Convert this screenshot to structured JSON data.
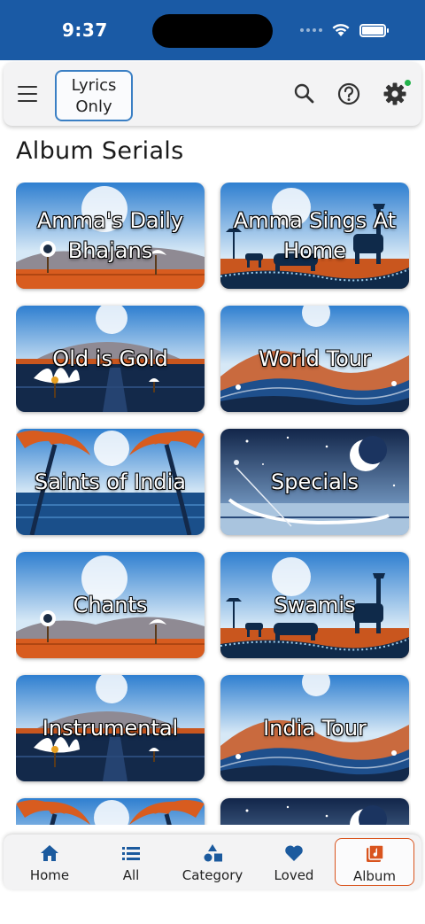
{
  "status_bar": {
    "time": "9:37"
  },
  "top_bar": {
    "lyrics_button_line1": "Lyrics",
    "lyrics_button_line2": "Only"
  },
  "section": {
    "title": "Album Serials"
  },
  "albums": [
    {
      "label": "Amma's Daily Bhajans",
      "scene": "lake"
    },
    {
      "label": "Amma Sings At Home",
      "scene": "animals"
    },
    {
      "label": "Old is Gold",
      "scene": "lotus"
    },
    {
      "label": "World Tour",
      "scene": "waves"
    },
    {
      "label": "Saints of India",
      "scene": "palms"
    },
    {
      "label": "Specials",
      "scene": "night"
    },
    {
      "label": "Chants",
      "scene": "lake"
    },
    {
      "label": "Swamis",
      "scene": "animals"
    },
    {
      "label": "Instrumental",
      "scene": "lotus"
    },
    {
      "label": "India Tour",
      "scene": "waves"
    },
    {
      "label": "",
      "scene": "palms"
    },
    {
      "label": "",
      "scene": "night"
    }
  ],
  "bottom_nav": [
    {
      "label": "Home",
      "icon": "home-icon",
      "active": false
    },
    {
      "label": "All",
      "icon": "list-icon",
      "active": false
    },
    {
      "label": "Category",
      "icon": "category-icon",
      "active": false
    },
    {
      "label": "Loved",
      "icon": "heart-icon",
      "active": false
    },
    {
      "label": "Album",
      "icon": "album-icon",
      "active": true
    }
  ],
  "colors": {
    "status_bar": "#1a5aa5",
    "accent": "#1b5a9e",
    "active_border": "#d9541e",
    "notification_dot": "#23b34b"
  }
}
